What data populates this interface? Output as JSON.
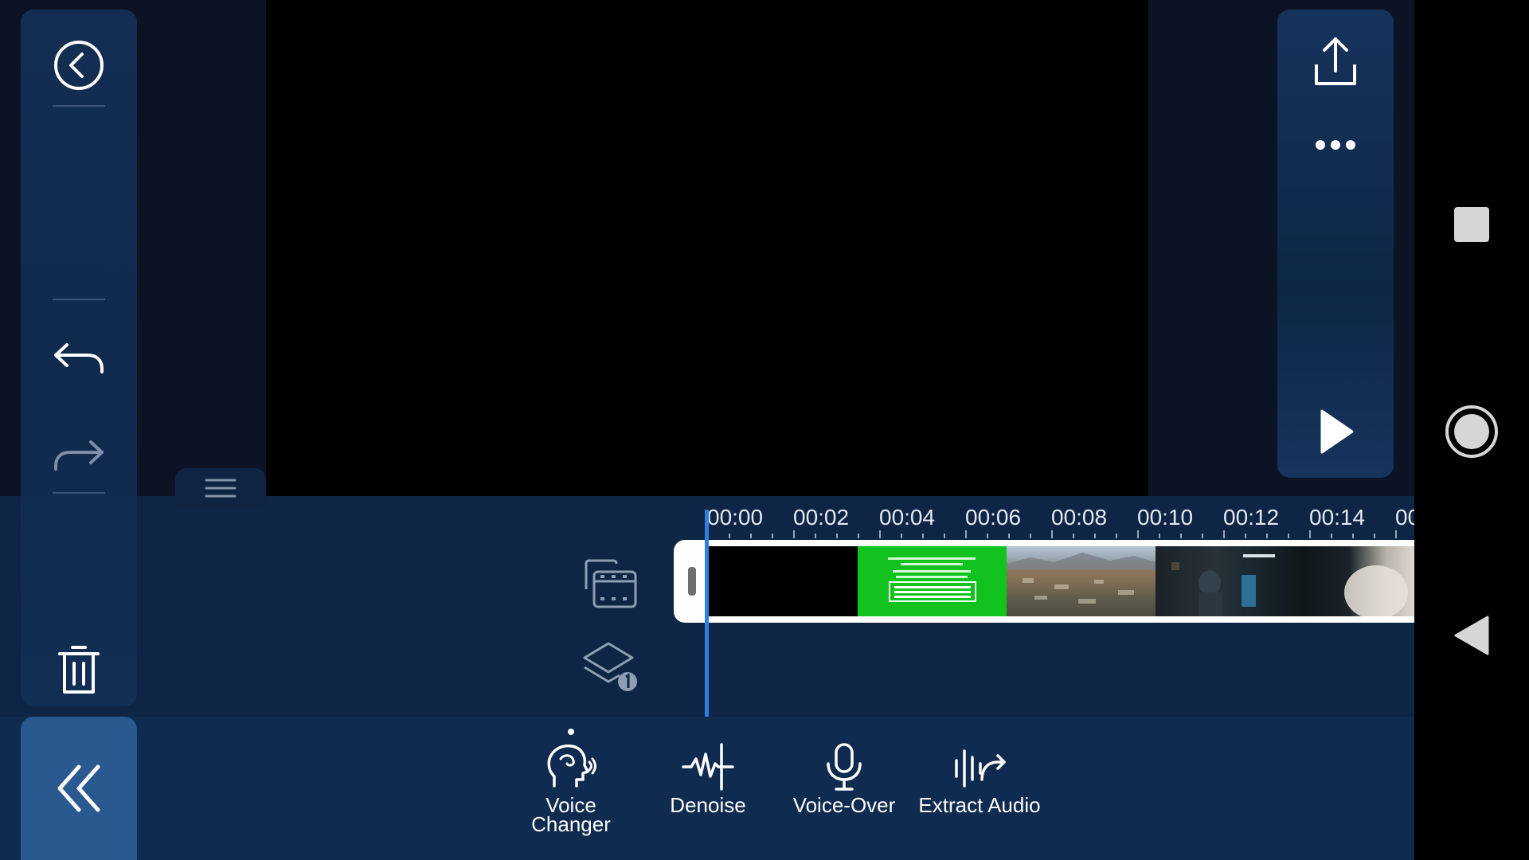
{
  "timeline": {
    "ruler_labels": [
      "00:00",
      "00:02",
      "00:04",
      "00:06",
      "00:08",
      "00:10",
      "00:12",
      "00:14",
      "00"
    ],
    "clip_thumbnails": [
      "black-frame",
      "green-screen-text-frame",
      "aerial-landscape-frame",
      "dark-scene-frame",
      "bright-closeup-frame"
    ]
  },
  "toolbar": {
    "tools": [
      {
        "label": "Voice\nChanger",
        "icon": "voice-changer-icon",
        "selected": true
      },
      {
        "label": "Denoise",
        "icon": "denoise-icon",
        "selected": false
      },
      {
        "label": "Voice-Over",
        "icon": "microphone-icon",
        "selected": false
      },
      {
        "label": "Extract Audio",
        "icon": "extract-audio-icon",
        "selected": false
      }
    ]
  },
  "colors": {
    "accent": "#2f7fe0",
    "panel": "#0f2a4d",
    "collapse_button": "#2a5990",
    "green_clip": "#12c21f"
  }
}
